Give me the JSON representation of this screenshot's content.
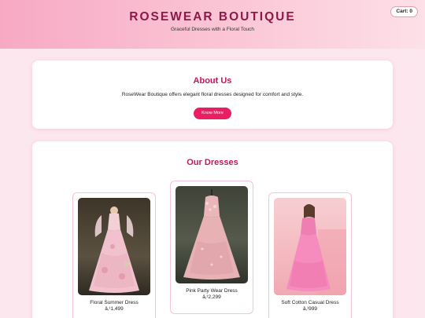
{
  "header": {
    "brand": "ROSEWEAR BOUTIQUE",
    "tagline": "Graceful Dresses with a Floral Touch",
    "cart_label": "Cart: 0"
  },
  "about": {
    "title": "About Us",
    "text": "RoseWear Boutique offers elegant floral dresses designed for comfort and style.",
    "button_label": "Know More"
  },
  "dresses": {
    "title": "Our Dresses",
    "items": [
      {
        "name": "Floral Summer Dress",
        "price": "â‚¹1,499",
        "image": "floral-summer-dress-photo"
      },
      {
        "name": "Pink Party Wear Dress",
        "price": "â‚¹2,299",
        "image": "pink-party-wear-dress-photo"
      },
      {
        "name": "Soft Cotton Casual Dress",
        "price": "â‚¹999",
        "image": "soft-cotton-casual-dress-photo"
      }
    ]
  },
  "colors": {
    "accent": "#e91e63",
    "title": "#c2185b",
    "brand": "#8a1a48",
    "background": "#fde7ee"
  }
}
